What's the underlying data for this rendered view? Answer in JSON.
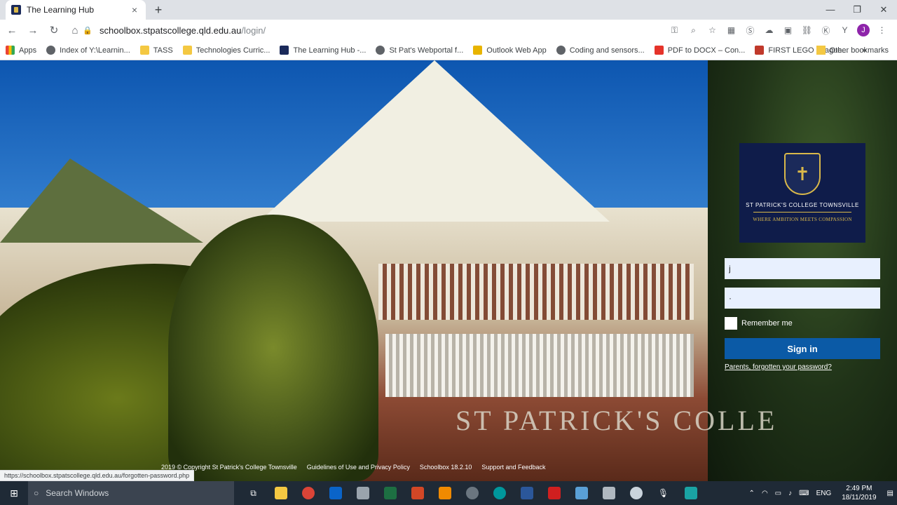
{
  "browser": {
    "tab_title": "The Learning Hub",
    "tab_close": "×",
    "new_tab": "+",
    "window_controls": [
      "—",
      "❐",
      "✕"
    ],
    "url_host": "schoolbox.stpatscollege.qld.edu.au",
    "url_path": "/login/",
    "nav": {
      "back": "←",
      "forward": "→",
      "reload": "↻",
      "home": "⌂"
    },
    "profile_initial": "J",
    "bookmarks": [
      {
        "label": "Apps",
        "icon": "apps-icon"
      },
      {
        "label": "Index of Y:\\Learnin...",
        "icon": "globe-icon"
      },
      {
        "label": "TASS",
        "icon": "folder-icon"
      },
      {
        "label": "Technologies Curric...",
        "icon": "folder-icon"
      },
      {
        "label": "The Learning Hub -...",
        "icon": "hub-icon"
      },
      {
        "label": "St Pat's Webportal f...",
        "icon": "globe-icon"
      },
      {
        "label": "Outlook Web App",
        "icon": "owa-icon"
      },
      {
        "label": "Coding and sensors...",
        "icon": "globe-icon"
      },
      {
        "label": "PDF to DOCX – Con...",
        "icon": "pdf-icon"
      },
      {
        "label": "FIRST LEGO League...",
        "icon": "flag-icon"
      }
    ],
    "bookmarks_more": "»",
    "other_bookmarks": "Other bookmarks"
  },
  "page": {
    "sign_text": "ST PATRICK'S COLLE",
    "crest": {
      "name": "ST PATRICK'S COLLEGE TOWNSVILLE",
      "motto": "WHERE AMBITION MEETS COMPASSION"
    },
    "login": {
      "username_value": "j",
      "password_value": "·",
      "remember_label": "Remember me",
      "signin_label": "Sign in",
      "forgot_label": "Parents, forgotten your password?"
    },
    "footer": [
      "2019 © Copyright St Patrick's College Townsville",
      "Guidelines of Use and Privacy Policy",
      "Schoolbox 18.2.10",
      "Support and Feedback"
    ]
  },
  "status_bar_url": "https://schoolbox.stpatscollege.qld.edu.au/forgotten-password.php",
  "taskbar": {
    "search_placeholder": "Search Windows",
    "tray_lang": "ENG",
    "time": "2:49 PM",
    "date": "18/11/2019"
  },
  "colors": {
    "crest_bg": "#0f1c4a",
    "crest_gold": "#d9b84a",
    "signin_bg": "#0b5aa6",
    "input_bg": "#e8f0fe"
  }
}
